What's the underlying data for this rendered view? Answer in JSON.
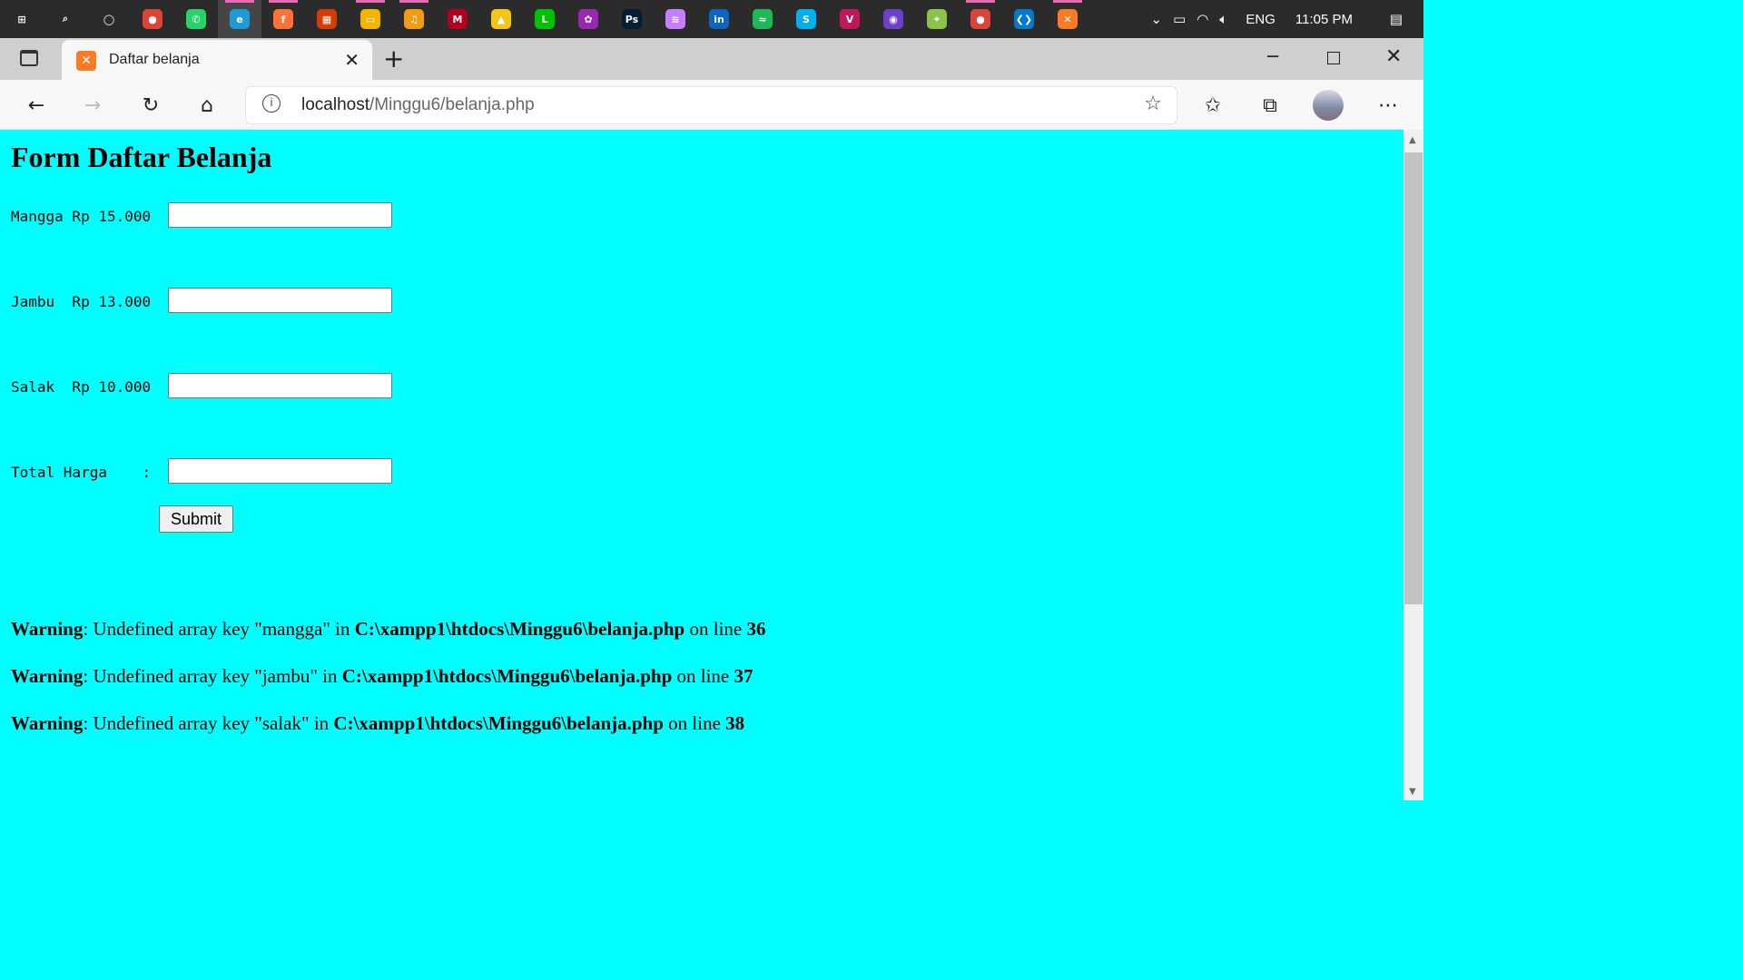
{
  "taskbar": {
    "apps": [
      {
        "icon": "windows-start-icon",
        "color": "#2b2b2b",
        "glyph": "⊞"
      },
      {
        "icon": "search-icon",
        "color": "#2b2b2b",
        "glyph": "⌕"
      },
      {
        "icon": "cortana-icon",
        "color": "#2b2b2b",
        "glyph": "◯"
      },
      {
        "icon": "chrome-icon",
        "color": "#db4437",
        "glyph": "●"
      },
      {
        "icon": "whatsapp-icon",
        "color": "#25d366",
        "glyph": "✆"
      },
      {
        "icon": "edge-icon",
        "color": "#1e9bd7",
        "glyph": "e"
      },
      {
        "icon": "firefox-icon",
        "color": "#ff7139",
        "glyph": "f"
      },
      {
        "icon": "office-icon",
        "color": "#d83b01",
        "glyph": "▦"
      },
      {
        "icon": "file-explorer-icon",
        "color": "#f4b400",
        "glyph": "▭"
      },
      {
        "icon": "music-app-icon",
        "color": "#f39c12",
        "glyph": "♫"
      },
      {
        "icon": "mendeley-icon",
        "color": "#b3001b",
        "glyph": "M"
      },
      {
        "icon": "app-triangle-icon",
        "color": "#f5c518",
        "glyph": "▲"
      },
      {
        "icon": "line-icon",
        "color": "#00c300",
        "glyph": "L"
      },
      {
        "icon": "picasa-icon",
        "color": "#9c27b0",
        "glyph": "✿"
      },
      {
        "icon": "photoshop-icon",
        "color": "#001e36",
        "glyph": "Ps"
      },
      {
        "icon": "layers-app-icon",
        "color": "#c77dff",
        "glyph": "≋"
      },
      {
        "icon": "linkedin-icon",
        "color": "#0a66c2",
        "glyph": "in"
      },
      {
        "icon": "spotify-icon",
        "color": "#1db954",
        "glyph": "≈"
      },
      {
        "icon": "skype-icon",
        "color": "#00aff0",
        "glyph": "S"
      },
      {
        "icon": "vectornator-icon",
        "color": "#c2185b",
        "glyph": "V"
      },
      {
        "icon": "github-icon",
        "color": "#6e40c9",
        "glyph": "◉"
      },
      {
        "icon": "app-leaf-icon",
        "color": "#8bc34a",
        "glyph": "✦"
      },
      {
        "icon": "chrome-profile-icon",
        "color": "#db4437",
        "glyph": "●"
      },
      {
        "icon": "vscode-icon",
        "color": "#007acc",
        "glyph": "❮❯"
      },
      {
        "icon": "xampp-icon",
        "color": "#fb7a24",
        "glyph": "✕"
      }
    ],
    "tray": {
      "language": "ENG",
      "time": "11:05 PM"
    }
  },
  "browser": {
    "tab_title": "Daftar belanja",
    "url_host": "localhost",
    "url_path": "/Minggu6/belanja.php"
  },
  "page": {
    "heading": "Form Daftar Belanja",
    "fields": [
      {
        "label": "Mangga Rp 15.000",
        "value": ""
      },
      {
        "label": "Jambu  Rp 13.000",
        "value": ""
      },
      {
        "label": "Salak  Rp 10.000",
        "value": ""
      },
      {
        "label": "Total Harga    :",
        "value": ""
      }
    ],
    "submit_label": "Submit",
    "warnings": [
      {
        "kind": "Warning",
        "message": ": Undefined array key \"mangga\" in ",
        "file": "C:\\xampp1\\htdocs\\Minggu6\\belanja.php",
        "on_line": " on line ",
        "line": "36"
      },
      {
        "kind": "Warning",
        "message": ": Undefined array key \"jambu\" in ",
        "file": "C:\\xampp1\\htdocs\\Minggu6\\belanja.php",
        "on_line": " on line ",
        "line": "37"
      },
      {
        "kind": "Warning",
        "message": ": Undefined array key \"salak\" in ",
        "file": "C:\\xampp1\\htdocs\\Minggu6\\belanja.php",
        "on_line": " on line ",
        "line": "38"
      }
    ]
  }
}
